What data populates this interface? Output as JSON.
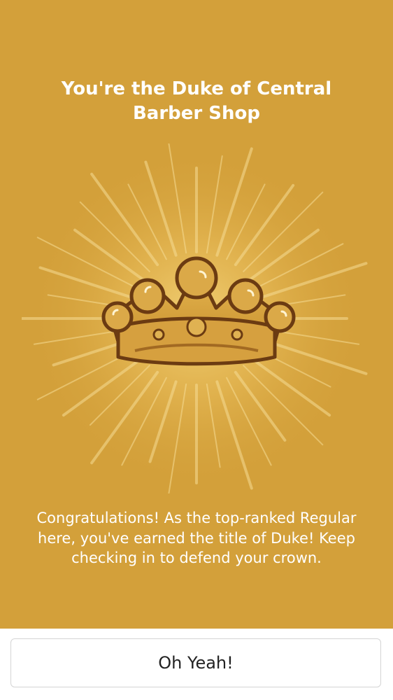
{
  "screen": {
    "title": "You're the Duke of Central Barber Shop",
    "badge_icon": "crown-icon",
    "message": "Congratulations! As the top-ranked Regular here, you've earned the title of Duke! Keep checking in to defend your crown.",
    "button_label": "Oh Yeah!"
  },
  "colors": {
    "background": "#d3a03a",
    "crown_fill": "#d9a640",
    "crown_outline": "#6b3b12",
    "button_text": "#222222"
  }
}
